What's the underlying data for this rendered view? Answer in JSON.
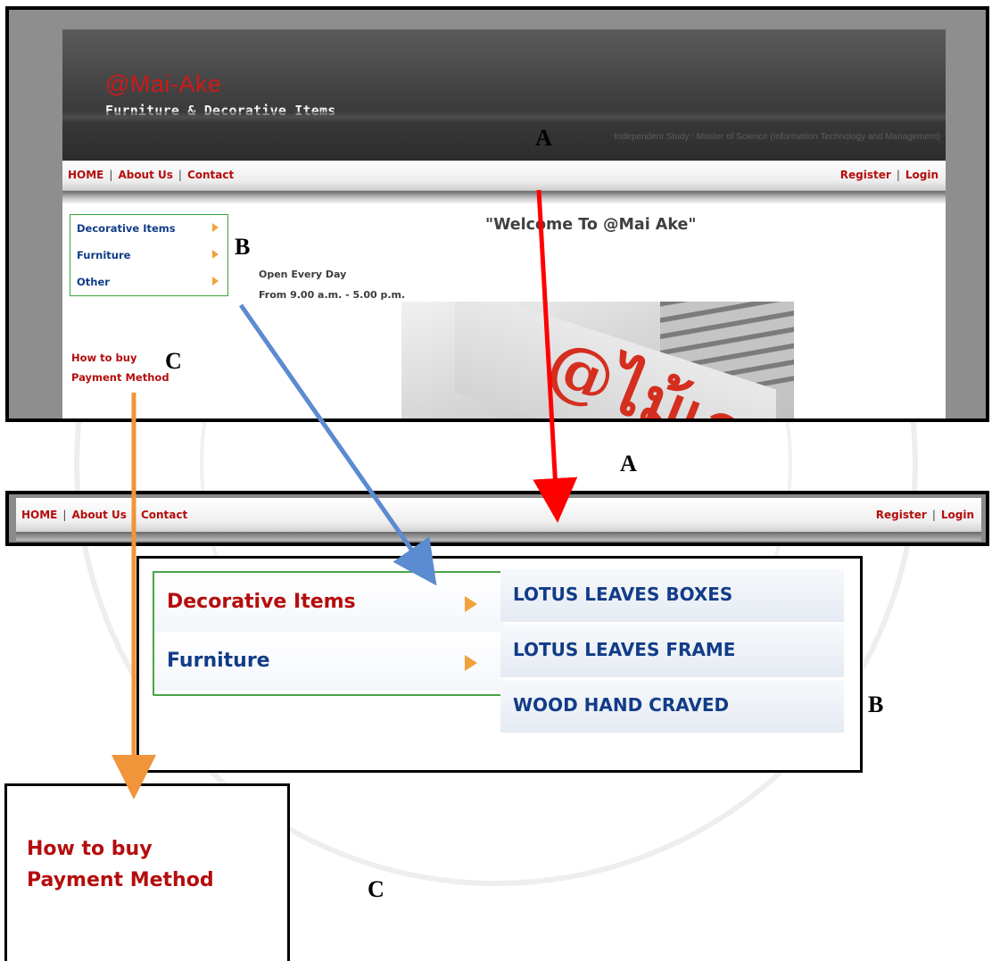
{
  "site": {
    "brand": "@Mai-Ake",
    "tagline": "Furniture & Decorative Items",
    "study_note": "Independent Study : Master of Science (Information Technology and Management)",
    "welcome": "\"Welcome To @Mai Ake\"",
    "open_line1": "Open Every Day",
    "open_line2": "From 9.00 a.m. - 5.00 p.m."
  },
  "nav": {
    "home": "HOME",
    "about": "About Us",
    "contact": "Contact",
    "register": "Register",
    "login": "Login",
    "separator": "|"
  },
  "categories": [
    "Decorative Items",
    "Furniture",
    "Other"
  ],
  "side_links": [
    "How to buy",
    "Payment Method"
  ],
  "submenu": [
    "LOTUS LEAVES BOXES",
    "LOTUS LEAVES FRAME",
    "WOOD HAND CRAVED"
  ],
  "markers": {
    "a": "A",
    "b": "B",
    "c": "C"
  },
  "colors": {
    "brand_red": "#cc1a1a",
    "link_red": "#b50d0d",
    "category_blue": "#123c88",
    "menu_arrow": "#f0a33c",
    "box_green": "#3aa23a",
    "arrow_a": "#ff0000",
    "arrow_b": "#5b8bd0",
    "arrow_c": "#f0953a"
  }
}
